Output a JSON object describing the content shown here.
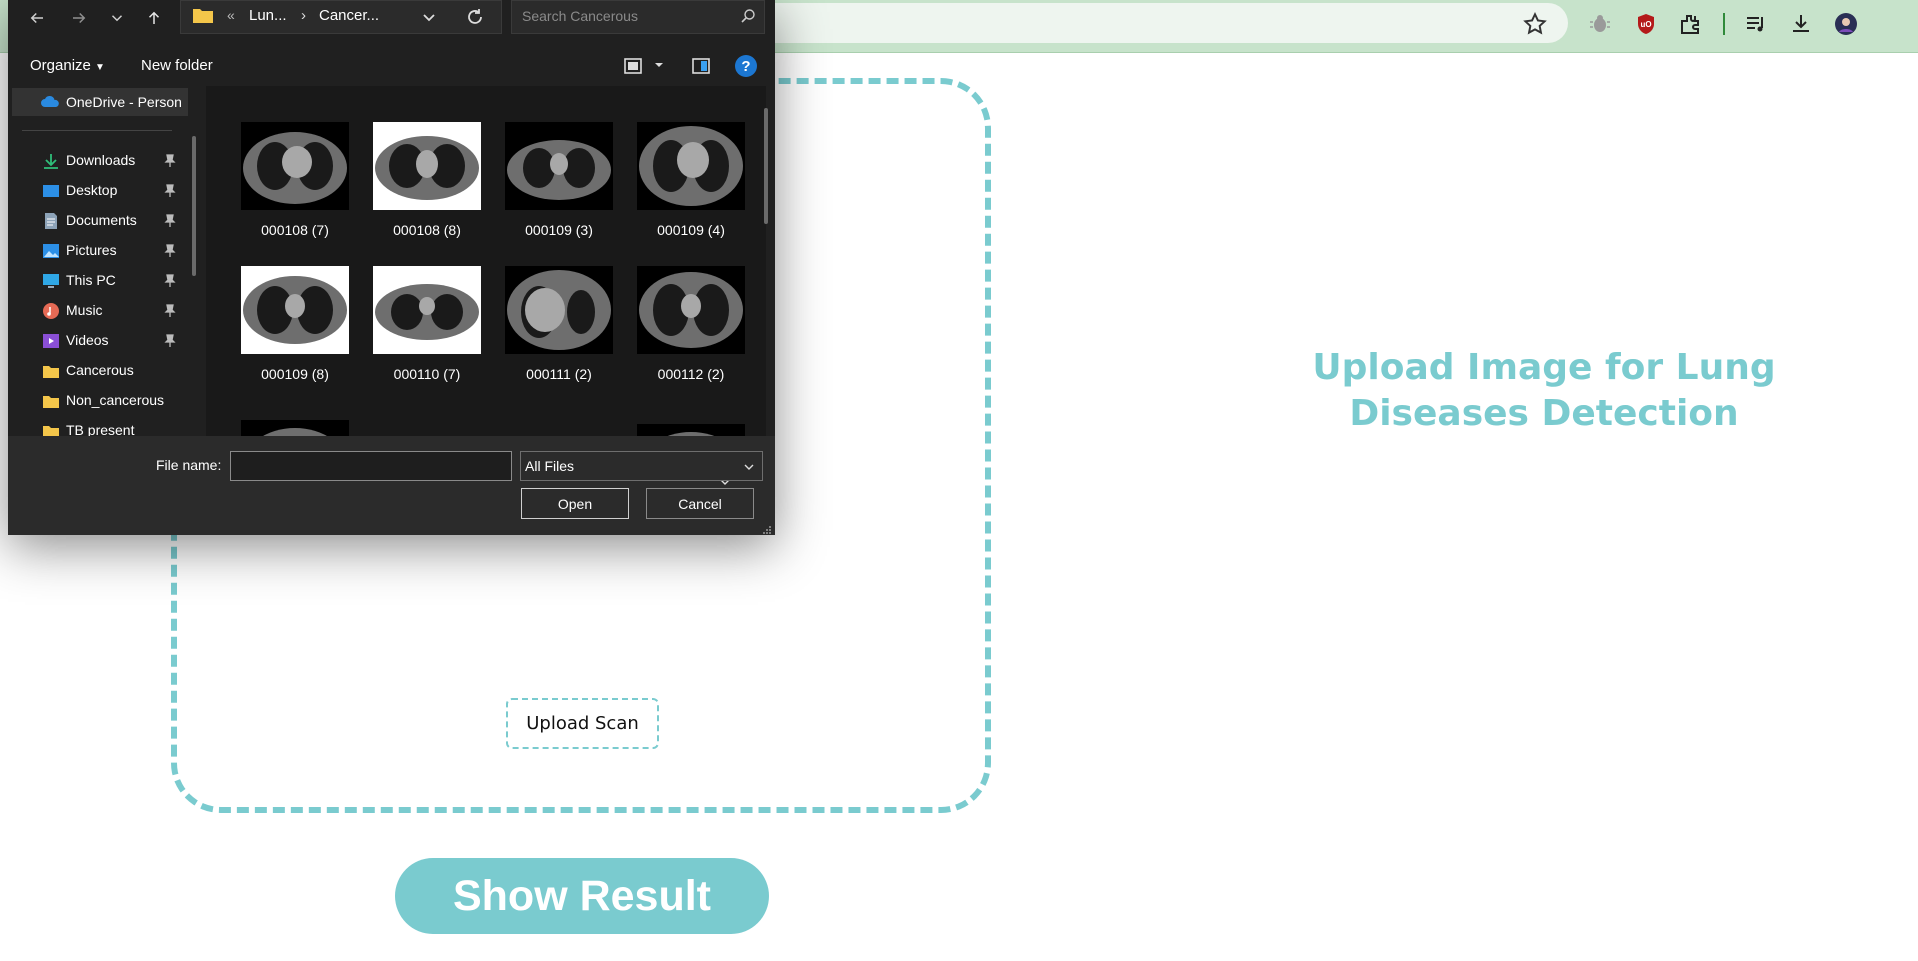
{
  "page": {
    "heading": "Upload Image for Lung Diseases Detection",
    "upload_button_label": "Upload Scan",
    "result_button_label": "Show Result",
    "accent_color": "#7acbcf"
  },
  "browser": {
    "toolbar_icons": [
      "star-icon",
      "bug-icon",
      "ublock-icon",
      "extensions-icon",
      "media-icon",
      "downloads-icon",
      "profile-avatar"
    ],
    "theme_color": "#c7e3cb"
  },
  "dialog": {
    "breadcrumb": {
      "overflow": "«",
      "items": [
        "Lun...",
        "Cancer..."
      ],
      "separator": "›"
    },
    "search_placeholder": "Search Cancerous",
    "toolbar": {
      "organize_label": "Organize",
      "new_folder_label": "New folder",
      "help_label": "?"
    },
    "nav": {
      "onedrive_label": "OneDrive - Person",
      "items": [
        {
          "label": "Downloads",
          "icon": "download-icon",
          "pinned": true
        },
        {
          "label": "Desktop",
          "icon": "desktop-icon",
          "pinned": true
        },
        {
          "label": "Documents",
          "icon": "documents-icon",
          "pinned": true
        },
        {
          "label": "Pictures",
          "icon": "pictures-icon",
          "pinned": true
        },
        {
          "label": "This PC",
          "icon": "pc-icon",
          "pinned": true
        },
        {
          "label": "Music",
          "icon": "music-icon",
          "pinned": true
        },
        {
          "label": "Videos",
          "icon": "videos-icon",
          "pinned": true
        },
        {
          "label": "Cancerous",
          "icon": "folder-icon",
          "pinned": false
        },
        {
          "label": "Non_cancerous",
          "icon": "folder-icon",
          "pinned": false
        },
        {
          "label": "TB present",
          "icon": "folder-icon",
          "pinned": false
        }
      ]
    },
    "files": [
      "000108 (7)",
      "000108 (8)",
      "000109 (3)",
      "000109 (4)",
      "000109 (8)",
      "000110 (7)",
      "000111 (2)",
      "000112 (2)"
    ],
    "footer": {
      "filename_label": "File name:",
      "filename_value": "",
      "filetype_value": "All Files",
      "open_label": "Open",
      "cancel_label": "Cancel"
    }
  }
}
